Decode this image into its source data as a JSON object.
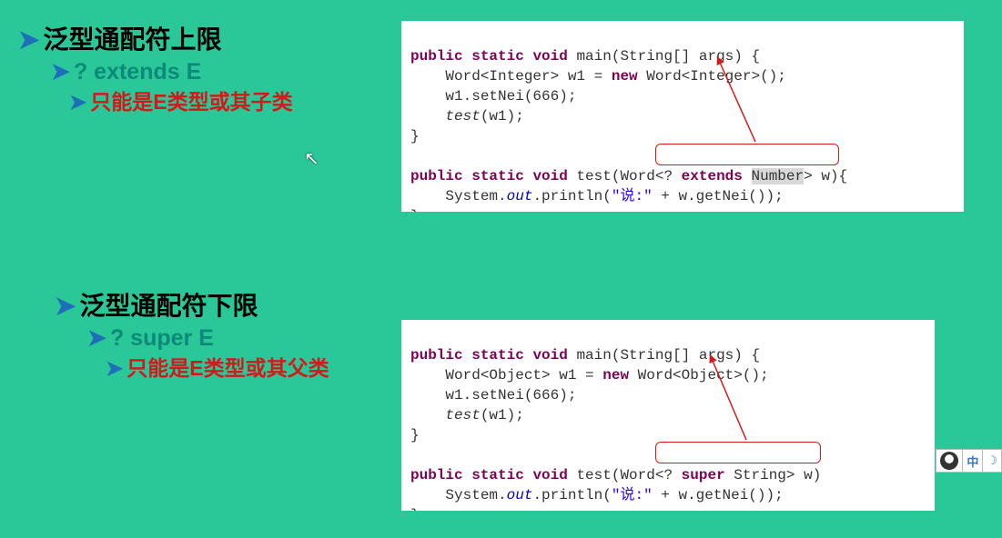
{
  "upper": {
    "title": "泛型通配符上限",
    "line2": "? extends E",
    "line3": "只能是E类型或其子类",
    "code": {
      "l01a": "public",
      "l01b": "static",
      "l01c": "void",
      "l01d": " main(String[] args) {",
      "l02a": "    Word<Integer> w1 = ",
      "l02b": "new",
      "l02c": " Word<Integer>();",
      "l03": "    w1.setNei(666);",
      "l04": "    test(w1);",
      "l04i": "test",
      "l05": "}",
      "l06": "",
      "l07a": "public",
      "l07b": "static",
      "l07c": "void",
      "l07d": " test(Word<? ",
      "l07e": "extends",
      "l07f": " ",
      "l07g": "Number",
      "l07h": "> w){",
      "l08a": "    System.",
      "l08b": "out",
      "l08c": ".println(",
      "l08d": "\"说:\"",
      "l08e": " + w.getNei());",
      "l09": "}"
    }
  },
  "lower": {
    "title": "泛型通配符下限",
    "line2": "? super E",
    "line3": "只能是E类型或其父类",
    "code": {
      "l01a": "public",
      "l01b": "static",
      "l01c": "void",
      "l01d": " main(String[] args) {",
      "l02a": "    Word<Object> w1 = ",
      "l02b": "new",
      "l02c": " Word<Object>();",
      "l03": "    w1.setNei(666);",
      "l04": "    test(w1);",
      "l04i": "test",
      "l05": "}",
      "l06": "",
      "l07a": "public",
      "l07b": "static",
      "l07c": "void",
      "l07d": " test(Word<? ",
      "l07e": "super",
      "l07f": " String> w)",
      "l08a": "    System.",
      "l08b": "out",
      "l08c": ".println(",
      "l08d": "\"说:\"",
      "l08e": " + w.getNei());",
      "l09": "}"
    }
  },
  "status": {
    "ime": "中"
  }
}
